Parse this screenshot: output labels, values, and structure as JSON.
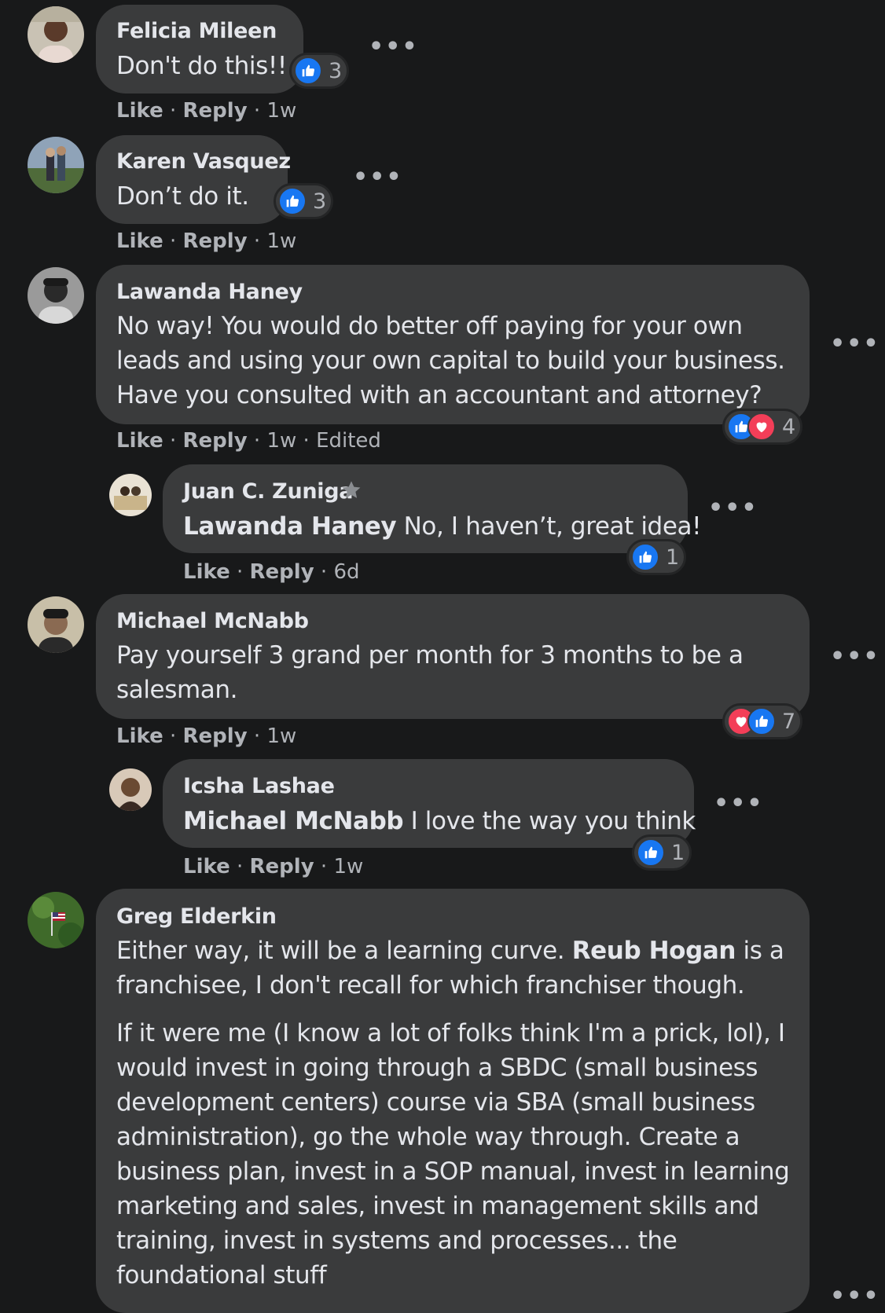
{
  "actions": {
    "like": "Like",
    "reply": "Reply",
    "sep": " · "
  },
  "colors": {
    "background": "#18191a",
    "bubble": "#3a3b3c",
    "like_blue": "#1877f2",
    "love_red": "#f33e58"
  },
  "comments": [
    {
      "author": "Felicia Mileen",
      "text": "Don't do this!!",
      "time": "1w",
      "reactions": "3"
    },
    {
      "author": "Karen Vasquez",
      "text": "Don’t do it.",
      "time": "1w",
      "reactions": "3"
    },
    {
      "author": "Lawanda Haney",
      "lines": [
        "No way! You would do better off paying for your own",
        "leads and using your own capital to build your business.",
        "Have you consulted with an accountant and attorney?"
      ],
      "time": "1w",
      "edited": "Edited",
      "reactions": "4"
    },
    {
      "author": "Juan C. Zuniga",
      "mention": "Lawanda Haney",
      "text": " No, I haven’t, great idea!",
      "time": "6d",
      "reactions": "1"
    },
    {
      "author": "Michael McNabb",
      "lines": [
        "Pay yourself 3 grand per month for 3 months to be a",
        "salesman."
      ],
      "time": "1w",
      "reactions": "7"
    },
    {
      "author": "Icsha Lashae",
      "mention": "Michael McNabb",
      "text": " I love the way you think",
      "time": "1w",
      "reactions": "1"
    },
    {
      "author": "Greg Elderkin",
      "p1_a": "Either way, it will be a learning curve. ",
      "p1_mention": "Reub Hogan",
      "p1_b": " is a",
      "p1_line2": "franchisee, I don't recall for which franchiser though.",
      "p2_lines": [
        "If it were me (I know a lot of folks think I'm a prick, lol), I",
        "would invest in going through a SBDC (small business",
        "development centers) course via SBA (small business",
        "administration), go the whole way through. Create a",
        "business plan, invest in a SOP manual, invest in learning",
        "marketing and sales, invest in management skills and",
        "training, invest in systems and processes... the",
        "foundational stuff"
      ]
    }
  ]
}
